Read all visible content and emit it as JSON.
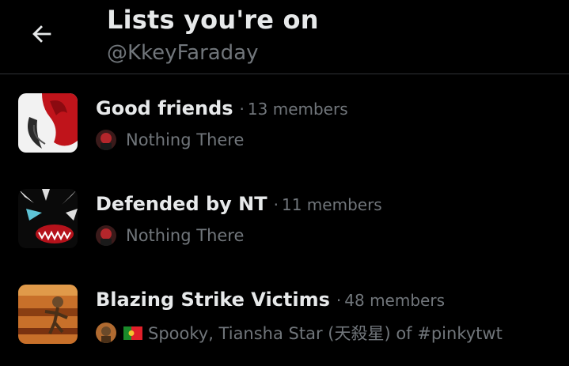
{
  "header": {
    "title": "Lists you're on",
    "username": "@KkeyFaraday"
  },
  "lists": [
    {
      "name": "Good friends",
      "members": "13 members",
      "owner": "Nothing There"
    },
    {
      "name": "Defended by NT",
      "members": "11 members",
      "owner": "Nothing There"
    },
    {
      "name": "Blazing Strike Victims",
      "members": "48 members",
      "owner": "Spooky, Tiansha Star (天殺星) of #pinkytwt"
    }
  ],
  "separator": "·",
  "colors": {
    "background": "#000000",
    "primary_text": "#e7e9ea",
    "secondary_text": "#71767b",
    "divider": "#2f3336"
  },
  "icons": {
    "back": "arrow-left-icon"
  }
}
